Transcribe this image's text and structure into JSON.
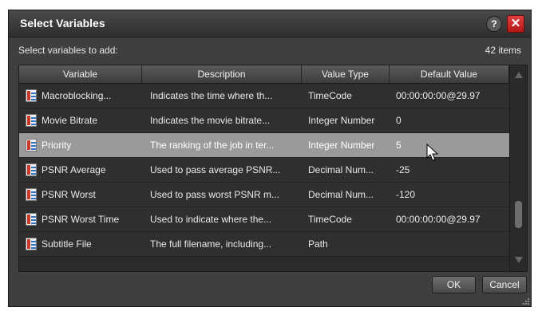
{
  "dialog": {
    "title": "Select Variables"
  },
  "buttons": {
    "help": "?",
    "close": "✕",
    "ok": "OK",
    "cancel": "Cancel"
  },
  "subbar": {
    "label": "Select variables to add:",
    "count": "42 items"
  },
  "table": {
    "columns": [
      "Variable",
      "Description",
      "Value Type",
      "Default Value"
    ],
    "rows": [
      {
        "variable": "Macroblocking...",
        "description": "Indicates the time where th...",
        "value_type": "TimeCode",
        "default_value": "00:00:00:00@29.97"
      },
      {
        "variable": "Movie Bitrate",
        "description": "Indicates the movie bitrate...",
        "value_type": "Integer Number",
        "default_value": "0"
      },
      {
        "variable": "Priority",
        "description": "The ranking of the job in ter...",
        "value_type": "Integer Number",
        "default_value": "5"
      },
      {
        "variable": "PSNR Average",
        "description": "Used to pass average PSNR...",
        "value_type": "Decimal Num...",
        "default_value": "-25"
      },
      {
        "variable": "PSNR Worst",
        "description": "Used to pass worst PSNR m...",
        "value_type": "Decimal Num...",
        "default_value": "-120"
      },
      {
        "variable": "PSNR Worst Time",
        "description": "Used to indicate where the...",
        "value_type": "TimeCode",
        "default_value": "00:00:00:00@29.97"
      },
      {
        "variable": "Subtitle File",
        "description": "The full filename, including...",
        "value_type": "Path",
        "default_value": ""
      }
    ],
    "selected_variable": "Priority"
  },
  "icons": {
    "row": "variable-list-icon",
    "cursor": "mouse-pointer-icon"
  }
}
